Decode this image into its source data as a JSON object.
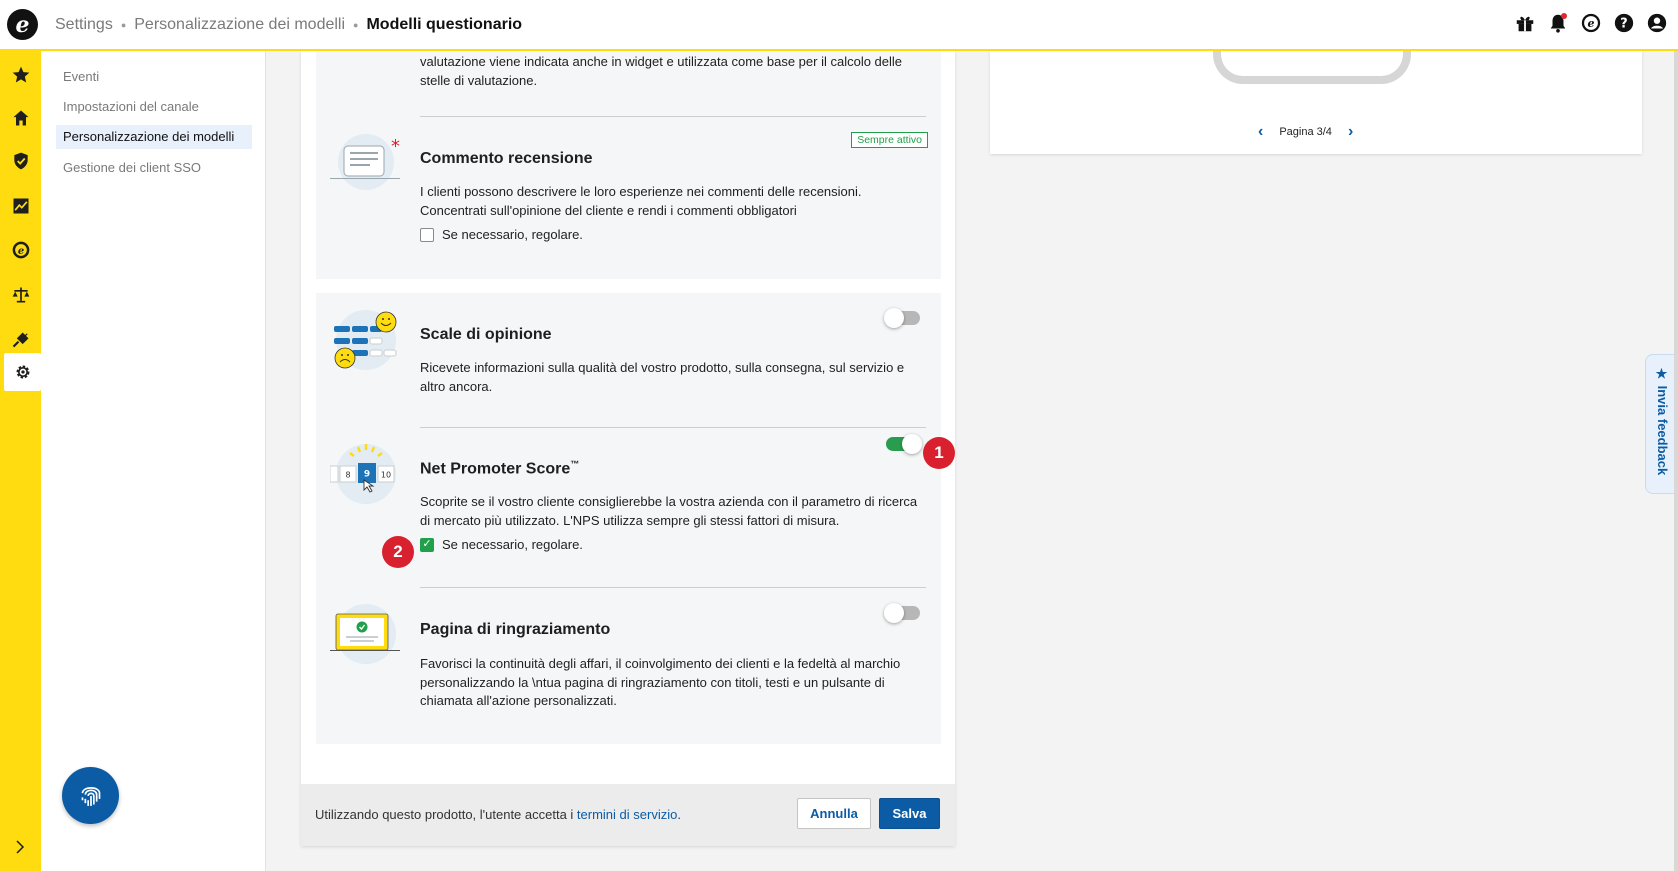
{
  "header": {
    "logo_letter": "e",
    "breadcrumb": [
      "Settings",
      "Personalizzazione dei modelli",
      "Modelli questionario"
    ],
    "icons": [
      "gift-icon",
      "bell-icon",
      "trusted-shops-icon",
      "help-icon",
      "account-icon"
    ]
  },
  "rail": {
    "items": [
      "star-icon",
      "home-icon",
      "shield-check-icon",
      "chart-icon",
      "euro-icon",
      "scale-icon",
      "plug-icon",
      "gear-icon"
    ],
    "active": "gear-icon",
    "expand_icon": "chevron-right-icon"
  },
  "subnav": {
    "items": [
      {
        "label": "Eventi",
        "active": false
      },
      {
        "label": "Impostazioni del canale",
        "active": false
      },
      {
        "label": "Personalizzazione dei modelli",
        "active": true
      },
      {
        "label": "Gestione dei client SSO",
        "active": false
      }
    ],
    "fingerprint_icon": "fingerprint-icon"
  },
  "main": {
    "top_partial_text": "valutazione viene indicata anche in widget e utilizzata come base per il calcolo delle stelle di valutazione.",
    "comment": {
      "title": "Commento recensione",
      "badge": "Sempre attivo",
      "description": "I clienti possono descrivere le loro esperienze nei commenti delle recensioni. Concentrati sull'opinione del cliente e rendi i commenti obbligatori",
      "checkbox_label": "Se necessario, regolare.",
      "checked": false
    },
    "opinion": {
      "title": "Scale di opinione",
      "description": "Ricevete informazioni sulla qualità del vostro prodotto, sulla consegna, sul servizio e altro ancora.",
      "enabled": false
    },
    "nps": {
      "title": "Net Promoter Score",
      "trademark": "™",
      "description": "Scoprite se il vostro cliente consiglierebbe la vostra azienda con il parametro di ricerca di mercato più utilizzato. L'NPS utilizza sempre gli stessi fattori di misura.",
      "checkbox_label": "Se necessario, regolare.",
      "checked": true,
      "enabled": true,
      "scale_numbers": [
        "8",
        "9",
        "10"
      ]
    },
    "thanks": {
      "title": "Pagina di ringraziamento",
      "description": "Favorisci la continuità degli affari, il coinvolgimento dei clienti e la fedeltà al marchio personalizzando la \\ntua pagina di ringraziamento con titoli, testi e un pulsante di chiamata all'azione personalizzati.",
      "enabled": false
    },
    "markers": [
      "1",
      "2"
    ],
    "footer": {
      "text": "Utilizzando questo prodotto, l'utente accetta i ",
      "link": "termini di servizio",
      "period": ".",
      "cancel": "Annulla",
      "save": "Salva"
    }
  },
  "preview": {
    "pager": "Pagina 3/4",
    "prev_icon": "chevron-left-icon",
    "next_icon": "chevron-right-icon"
  },
  "feedback": {
    "label": "Invia feedback",
    "icon": "star-icon"
  },
  "colors": {
    "brand_yellow": "#ffdc0f",
    "primary_blue": "#0c5ca5",
    "success_green": "#20a04a",
    "marker_red": "#d8202e"
  }
}
